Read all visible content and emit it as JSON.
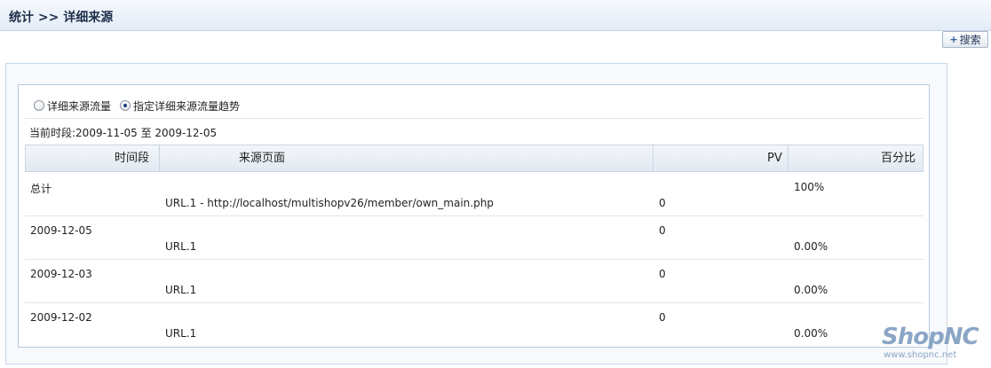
{
  "header": {
    "title": "统计  >> 详细来源"
  },
  "search_button": {
    "label": "搜索"
  },
  "radios": [
    {
      "label": "详细来源流量",
      "checked": false
    },
    {
      "label": "指定详细来源流量趋势",
      "checked": true
    }
  ],
  "period": {
    "label": "当前时段:2009-11-05 至  2009-12-05"
  },
  "table": {
    "columns": [
      "时间段",
      "来源页面",
      "PV",
      "百分比"
    ],
    "groups": [
      {
        "period": "总计",
        "group_percent": "100%",
        "source": "URL.1 - http://localhost/multishopv26/member/own_main.php",
        "pv": "0",
        "percent": ""
      },
      {
        "period": "2009-12-05",
        "group_pv": "0",
        "source": "URL.1",
        "percent": "0.00%"
      },
      {
        "period": "2009-12-03",
        "group_pv": "0",
        "source": "URL.1",
        "percent": "0.00%"
      },
      {
        "period": "2009-12-02",
        "group_pv": "0",
        "source": "URL.1",
        "percent": "0.00%"
      }
    ]
  },
  "brand": {
    "logo_text": "ShopNC",
    "url": "www.shopnc.net"
  }
}
